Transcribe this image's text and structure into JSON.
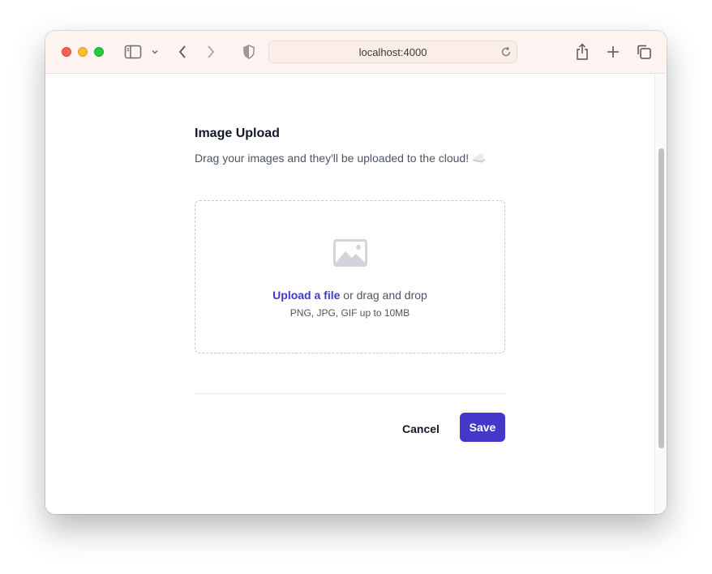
{
  "browser": {
    "url": "localhost:4000"
  },
  "upload": {
    "title": "Image Upload",
    "description": "Drag your images and they'll be uploaded to the cloud! ☁️",
    "link_label": "Upload a file",
    "drop_text": " or drag and drop",
    "hint": "PNG, JPG, GIF up to 10MB"
  },
  "actions": {
    "cancel_label": "Cancel",
    "save_label": "Save"
  },
  "colors": {
    "accent": "#4338ca",
    "titlebar": "#fdf4f1"
  },
  "icons": [
    "sidebar-icon",
    "chevron-down-icon",
    "back-icon",
    "forward-icon",
    "shield-icon",
    "reload-icon",
    "share-icon",
    "plus-icon",
    "tabs-icon",
    "photo-icon"
  ]
}
